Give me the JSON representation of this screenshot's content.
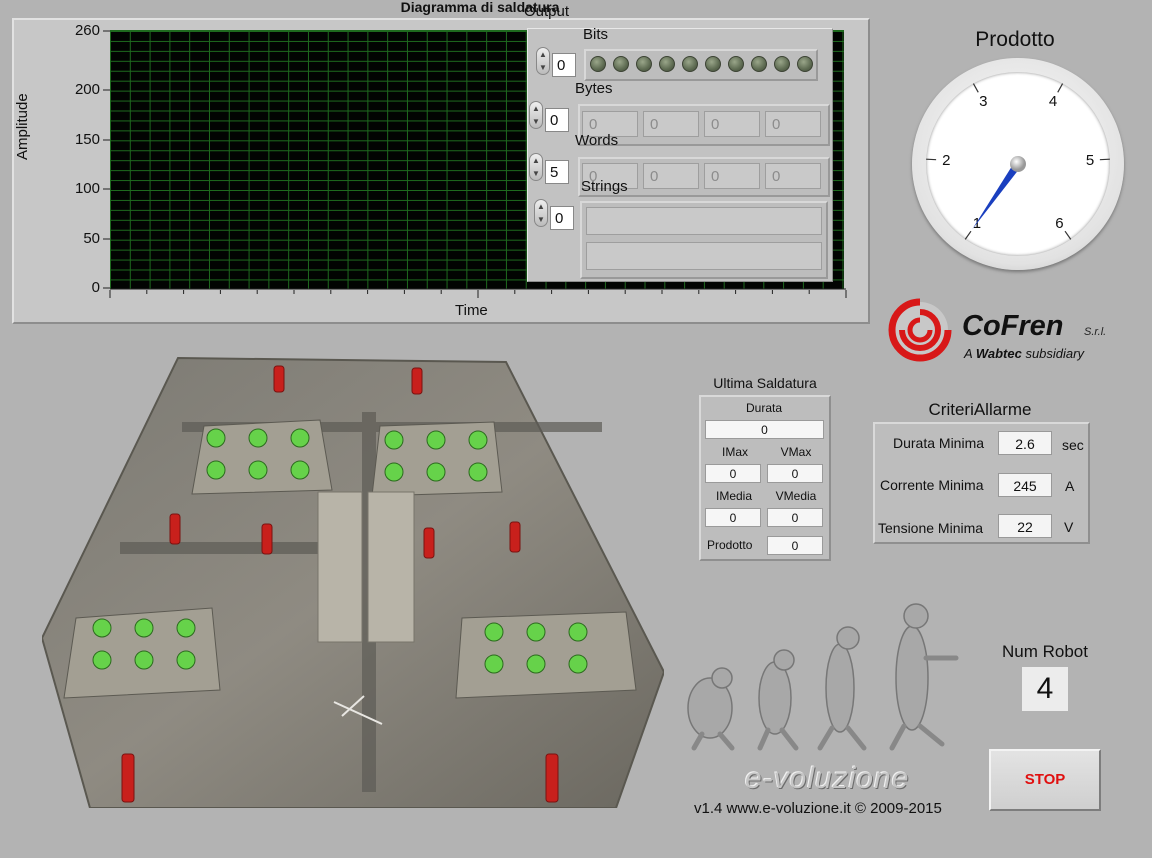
{
  "graph": {
    "title": "Diagramma di saldatura",
    "y_label": "Amplitude",
    "x_label": "Time",
    "y_ticks": [
      "260",
      "200",
      "150",
      "100",
      "50",
      "0"
    ]
  },
  "output": {
    "title": "Output",
    "bits": {
      "label": "Bits",
      "index": "0",
      "leds": [
        false,
        false,
        false,
        false,
        false,
        false,
        false,
        false,
        false,
        false
      ]
    },
    "bytes": {
      "label": "Bytes",
      "index": "0",
      "values": [
        "0",
        "0",
        "0",
        "0"
      ]
    },
    "words": {
      "label": "Words",
      "index": "5",
      "values": [
        "0",
        "0",
        "0",
        "0"
      ]
    },
    "strings": {
      "label": "Strings",
      "index": "0",
      "values": [
        "",
        ""
      ]
    }
  },
  "gauge": {
    "title": "Prodotto",
    "labels": [
      "1",
      "2",
      "3",
      "4",
      "5",
      "6"
    ],
    "value": 1,
    "colors": {
      "needle": "#1a3fbf"
    }
  },
  "logo": {
    "brand": "CoFren",
    "suffix": "S.r.l.",
    "tagline_a": "A",
    "tagline_b": "Wabtec",
    "tagline_c": "subsidiary",
    "color": "#d81818"
  },
  "ultima_saldatura": {
    "title": "Ultima Saldatura",
    "durata_label": "Durata",
    "durata": "0",
    "imax_label": "IMax",
    "imax": "0",
    "vmax_label": "VMax",
    "vmax": "0",
    "imedia_label": "IMedia",
    "imedia": "0",
    "vmedia_label": "VMedia",
    "vmedia": "0",
    "prodotto_label": "Prodotto",
    "prodotto": "0"
  },
  "criteri_allarme": {
    "title": "CriteriAllarme",
    "rows": [
      {
        "label": "Durata Minima",
        "value": "2.6",
        "unit": "sec"
      },
      {
        "label": "Corrente Minima",
        "value": "245",
        "unit": "A"
      },
      {
        "label": "Tensione Minima",
        "value": "22",
        "unit": "V"
      }
    ]
  },
  "num_robot": {
    "label": "Num Robot",
    "value": "4"
  },
  "stop_label": "STOP",
  "evo_word": "e-voluzione",
  "footer": "v1.4  www.e-voluzione.it  © 2009-2015",
  "photo": {
    "station_leds_on": true,
    "led_color": "#66d24a"
  }
}
